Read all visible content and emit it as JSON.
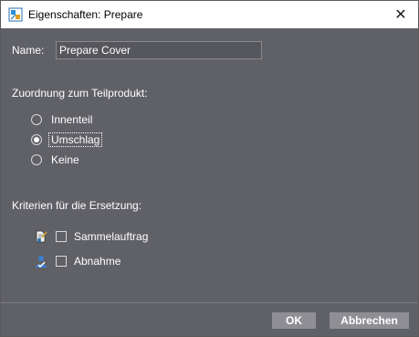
{
  "window": {
    "title": "Eigenschaften: Prepare",
    "close_glyph": "✕"
  },
  "name_field": {
    "label": "Name:",
    "value": "Prepare Cover"
  },
  "assignment": {
    "heading": "Zuordnung zum Teilprodukt:",
    "options": [
      {
        "label": "Innenteil",
        "checked": false
      },
      {
        "label": "Umschlag",
        "checked": true
      },
      {
        "label": "Keine",
        "checked": false
      }
    ]
  },
  "criteria": {
    "heading": "Kriterien für die Ersetzung:",
    "items": [
      {
        "label": "Sammelauftrag",
        "checked": false,
        "icon": "collective-order-icon"
      },
      {
        "label": "Abnahme",
        "checked": false,
        "icon": "approval-icon"
      }
    ]
  },
  "buttons": {
    "ok": "OK",
    "cancel": "Abbrechen"
  }
}
